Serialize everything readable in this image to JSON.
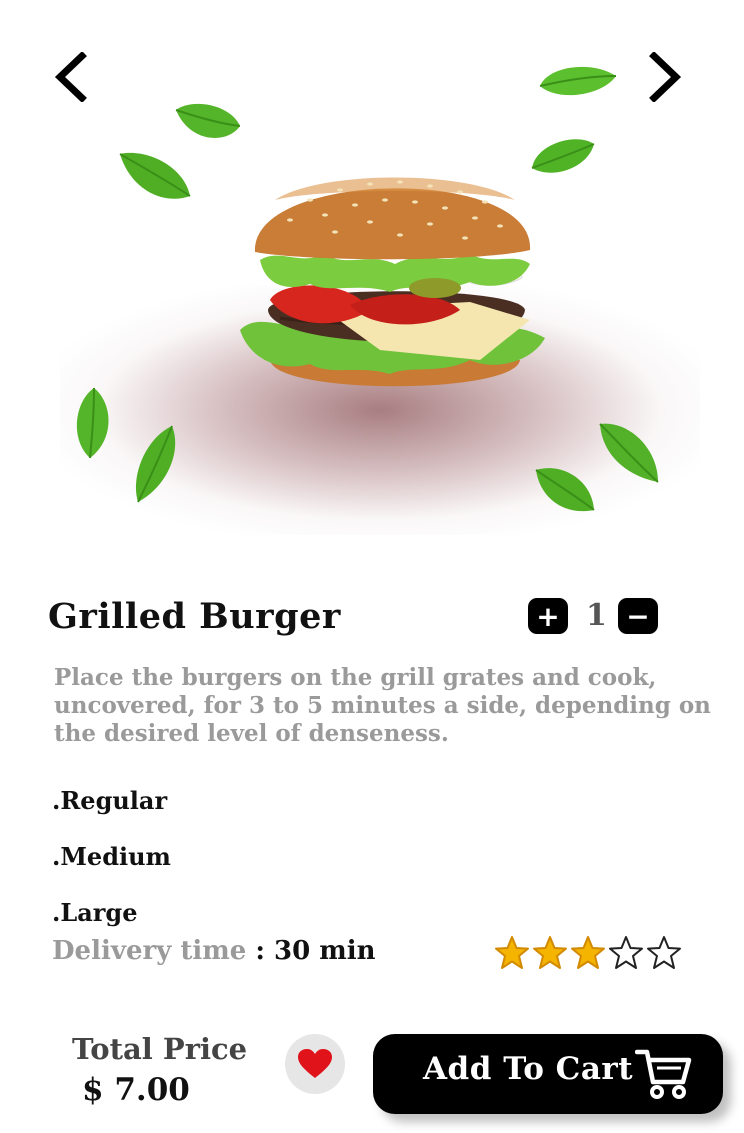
{
  "product": {
    "name": "Grilled Burger",
    "quantity": "1",
    "description": "Place the burgers on the grill grates and cook, uncovered, for 3 to 5 minutes a side, depending on the desired level of denseness."
  },
  "quantity_controls": {
    "increase": "+",
    "decrease": "−"
  },
  "sizes": [
    ".Regular",
    ".Medium",
    ".Large"
  ],
  "delivery": {
    "label": "Delivery time",
    "value": " : 30 min"
  },
  "rating": {
    "value": 3,
    "max": 5
  },
  "footer": {
    "total_label": "Total Price",
    "price": "$ 7.00",
    "cart_label": "Add To Cart"
  },
  "icons": {
    "back": "chevron-left-icon",
    "next": "chevron-right-icon",
    "favorite": "heart-icon",
    "cart": "cart-icon"
  },
  "colors": {
    "accent": "#000000",
    "heart": "#e0121a",
    "star": "#f5b400",
    "muted_text": "#9a9a9a",
    "leaf": "#4cae22"
  }
}
